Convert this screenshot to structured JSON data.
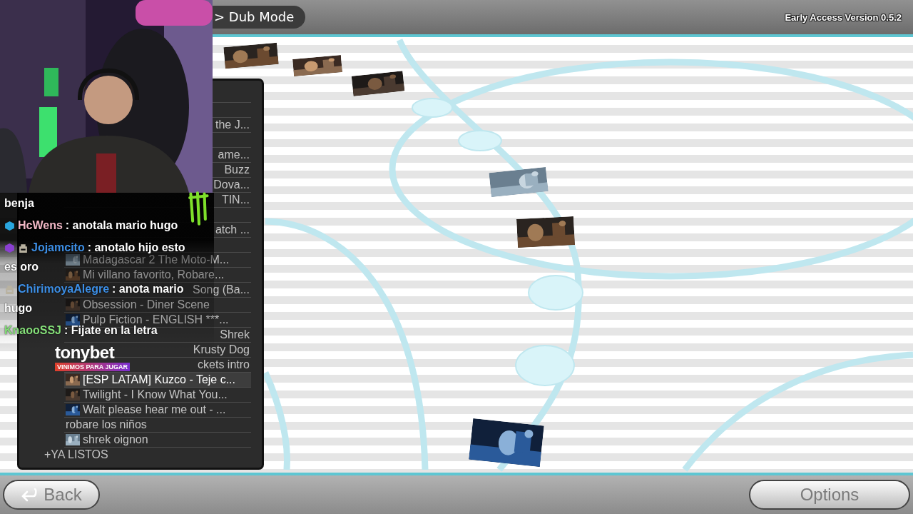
{
  "header": {
    "breadcrumb": "> Dub Mode",
    "version": "Early Access Version 0.5.2"
  },
  "track_nodes": [
    {
      "kind": "picture"
    },
    {
      "kind": "picture"
    },
    {
      "kind": "picture"
    },
    {
      "kind": "empty"
    },
    {
      "kind": "empty"
    },
    {
      "kind": "picture"
    },
    {
      "kind": "picture"
    },
    {
      "kind": "empty"
    },
    {
      "kind": "empty"
    },
    {
      "kind": "picture"
    }
  ],
  "playlist": {
    "rows": [
      {
        "kind": "covered"
      },
      {
        "kind": "covered"
      },
      {
        "kind": "tail",
        "title": "the J...",
        "selected": false
      },
      {
        "kind": "covered"
      },
      {
        "kind": "tail",
        "title": "ame...",
        "selected": false
      },
      {
        "kind": "tail",
        "title": "Buzz",
        "selected": false
      },
      {
        "kind": "tail",
        "title": "Dova...",
        "selected": false
      },
      {
        "kind": "tail",
        "title": "TIN...",
        "selected": false
      },
      {
        "kind": "covered"
      },
      {
        "kind": "tail",
        "title": "atch ...",
        "selected": false
      },
      {
        "kind": "covered"
      },
      {
        "kind": "full",
        "title": "Madagascar 2 The Moto-M...",
        "selected": false
      },
      {
        "kind": "full",
        "title": "Mi villano favorito, Robare...",
        "selected": false
      },
      {
        "kind": "tail",
        "title": "Song (Ba...",
        "selected": false
      },
      {
        "kind": "full",
        "title": "Obsession - Diner Scene",
        "selected": false
      },
      {
        "kind": "full",
        "title": "Pulp Fiction - ENGLISH ***...",
        "selected": false
      },
      {
        "kind": "tail",
        "title": "Shrek",
        "selected": false
      },
      {
        "kind": "tail",
        "title": "Krusty Dog",
        "selected": false
      },
      {
        "kind": "tail",
        "title": "ckets intro",
        "selected": false
      },
      {
        "kind": "full",
        "title": "[ESP LATAM] Kuzco - Teje c...",
        "selected": true
      },
      {
        "kind": "full",
        "title": "Twilight - I Know What You...",
        "selected": false
      },
      {
        "kind": "full",
        "title": "Walt please hear me out - ...",
        "selected": false
      },
      {
        "kind": "plain",
        "title": "robare los niños",
        "selected": false
      },
      {
        "kind": "full",
        "title": "shrek oignon",
        "selected": false
      },
      {
        "kind": "group",
        "title": "+YA LISTOS",
        "selected": false
      }
    ]
  },
  "chat": {
    "lines": [
      {
        "message": "benja"
      },
      {
        "user": "HcWens",
        "color": "#f2b8c6",
        "badges": [
          {
            "kind": "cube",
            "color": "#2aa6df"
          }
        ],
        "message": ": anotala mario hugo"
      },
      {
        "user": "Jojamcito",
        "color": "#3d8fe6",
        "badges": [
          {
            "kind": "cube",
            "color": "#8a3fd1"
          },
          {
            "kind": "bot"
          }
        ],
        "message": ": anotalo hijo esto",
        "continuation": "es oro"
      },
      {
        "user": "ChirimoyaAlegre",
        "color": "#3d8fe6",
        "badges": [
          {
            "kind": "bot"
          }
        ],
        "message": ": anota mario",
        "continuation": "hugo"
      },
      {
        "user": "KnaooSSJ",
        "color": "#86e07a",
        "message": ": Fijate en la letra"
      }
    ]
  },
  "sponsor": {
    "logo": "tonybet",
    "slogan": "VINIMOS PARA JUGAR"
  },
  "buttons": [
    {
      "kind": "back",
      "label": "Back"
    },
    {
      "kind": "options",
      "label": "Options"
    }
  ]
}
